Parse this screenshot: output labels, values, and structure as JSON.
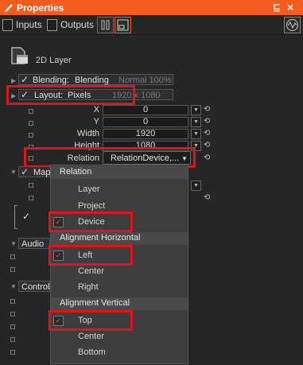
{
  "titlebar": {
    "title": "Properties",
    "pin_glyph": "⊑",
    "close_glyph": "×"
  },
  "toolbar": {
    "inputs_label": "Inputs",
    "outputs_label": "Outputs"
  },
  "layer": {
    "name": "2D Layer"
  },
  "blending": {
    "label": "Blending:",
    "value": "Blending",
    "dim": "Normal 100%"
  },
  "layout": {
    "label": "Layout:",
    "value": "Pixels",
    "dim": "1920 x 1080"
  },
  "fields": {
    "x_label": "X",
    "x_value": "0",
    "y_label": "Y",
    "y_value": "0",
    "width_label": "Width",
    "width_value": "1920",
    "height_label": "Height",
    "height_value": "1080",
    "relation_label": "Relation",
    "relation_value": "RelationDevice,..."
  },
  "sections": {
    "mapping": "Map",
    "audio": "Audio",
    "controls": "Control"
  },
  "popup": {
    "relation_header": "Relation",
    "relation_items": [
      "Layer",
      "Project",
      "Device"
    ],
    "halign_header": "Alignment Horizontal",
    "halign_items": [
      "Left",
      "Center",
      "Right"
    ],
    "valign_header": "Alignment Vertical",
    "valign_items": [
      "Top",
      "Center",
      "Bottom"
    ],
    "checked": [
      "Device",
      "Left",
      "Top"
    ]
  },
  "icons": {
    "check": "✓",
    "collapse": "▶",
    "expand": "▼",
    "dropdown": "▼",
    "reset": "⟲"
  },
  "colors": {
    "accent": "#f25c1d",
    "highlight": "#e0141e",
    "background": "#262626",
    "menu": "#3d3d3d"
  }
}
